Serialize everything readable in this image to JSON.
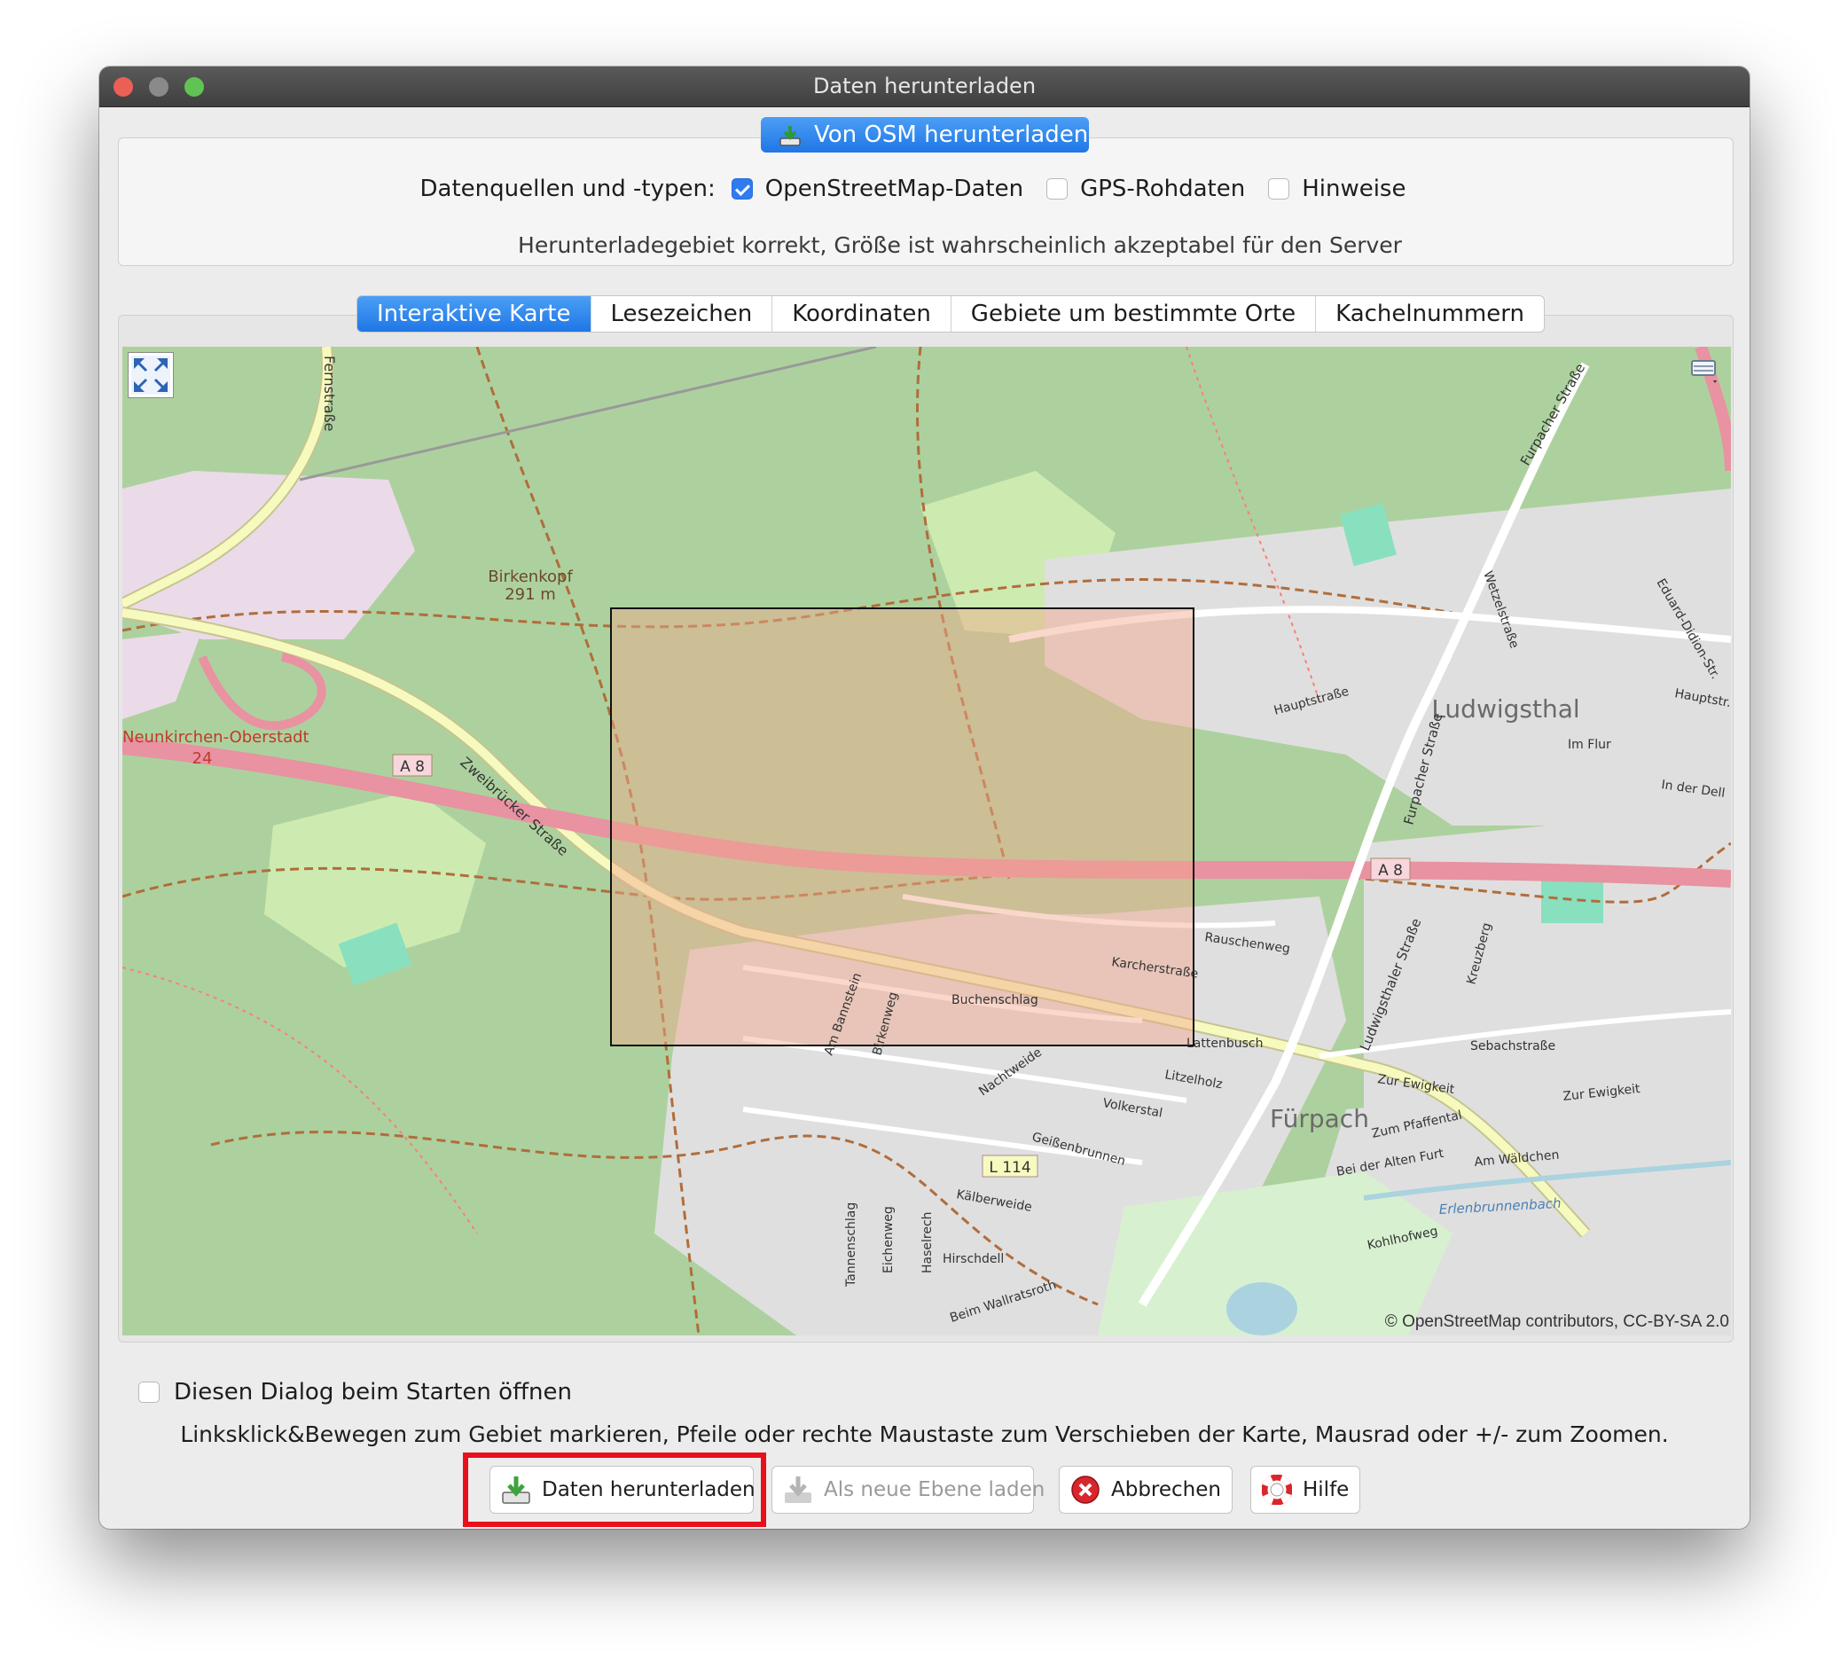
{
  "window": {
    "title": "Daten herunterladen"
  },
  "source_panel": {
    "osm_button_label": "Von OSM herunterladen",
    "sources_label": "Datenquellen und -typen:",
    "sources": [
      {
        "label": "OpenStreetMap-Daten",
        "checked": true
      },
      {
        "label": "GPS-Rohdaten",
        "checked": false
      },
      {
        "label": "Hinweise",
        "checked": false
      }
    ],
    "status": "Herunterladegebiet korrekt, Größe ist wahrscheinlich akzeptabel für den Server"
  },
  "tabs": [
    {
      "label": "Interaktive Karte",
      "active": true
    },
    {
      "label": "Lesezeichen",
      "active": false
    },
    {
      "label": "Koordinaten",
      "active": false
    },
    {
      "label": "Gebiete um bestimmte Orte",
      "active": false
    },
    {
      "label": "Kachelnummern",
      "active": false
    }
  ],
  "map": {
    "labels": {
      "birkenkopf": "Birkenkopf",
      "birkenkopf_elev": "291 m",
      "neunkirchen": "Neunkirchen-Oberstadt",
      "neunkirchen_num": "24",
      "ludwigsthal": "Ludwigsthal",
      "furpach": "Fürpach",
      "a8_left": "A 8",
      "a8_right": "A 8",
      "l114": "L 114",
      "zweibruecker": "Zweibrücker Straße",
      "fernstrasse": "Fernstraße",
      "furpacher": "Furpacher Straße",
      "furpacher2": "Furpacher Straße",
      "ludwigsthaler": "Ludwigsthaler Straße",
      "hauptstrasse": "Hauptstraße",
      "hauptstrasse2": "Hauptstr.",
      "rauschenweg": "Rauschenweg",
      "karcherstrasse": "Karcherstraße",
      "buchenschlag": "Buchenschlag",
      "lattenbusch": "Lattenbusch",
      "litzelholz": "Litzelholz",
      "volkerstal": "Volkerstal",
      "geissenbrunnen": "Geißenbrunnen",
      "kaelberweide": "Kälberweide",
      "hirschdell": "Hirschdell",
      "wallratsroth": "Beim Wallratsroth",
      "erlenbrunnenbach": "Erlenbrunnenbach",
      "kohlhofweg": "Kohlhofweg",
      "sebachstrasse": "Sebachstraße",
      "zur_ewigkeit": "Zur Ewigkeit",
      "zur_ewigkeit2": "Zur Ewigkeit",
      "zum_pfaffental": "Zum Pfaffental",
      "am_waeldchen": "Am Wäldchen",
      "alten_furt": "Bei der Alten Furt",
      "im_flur": "Im Flur",
      "in_der_dell": "In der Dell",
      "nachtweide": "Nachtweide",
      "birkenweg": "Birkenweg",
      "am_bannstein": "Am Bannstein",
      "tannenschlag": "Tannenschlag",
      "eichenweg": "Eichenweg",
      "haselrech": "Haselrech",
      "wetzelstrasse": "Wetzelstraße",
      "kreuzberg": "Kreuzberg",
      "eduard_didion": "Eduard-Didion-Str."
    },
    "attribution": "© OpenStreetMap contributors, CC-BY-SA 2.0",
    "colors": {
      "forest": "#add19e",
      "residential": "#e0dfdf",
      "motorway": "#e892a2",
      "primary": "#f7fabf",
      "selection": "#e8b4a0"
    }
  },
  "footer": {
    "startup_label": "Diesen Dialog beim Starten öffnen",
    "startup_checked": false,
    "help_text": "Linksklick&Bewegen zum Gebiet markieren, Pfeile oder rechte Maustaste zum Verschieben der Karte, Mausrad oder +/- zum Zoomen.",
    "buttons": {
      "download": "Daten herunterladen",
      "new_layer": "Als neue Ebene laden",
      "cancel": "Abbrechen",
      "help": "Hilfe"
    }
  }
}
